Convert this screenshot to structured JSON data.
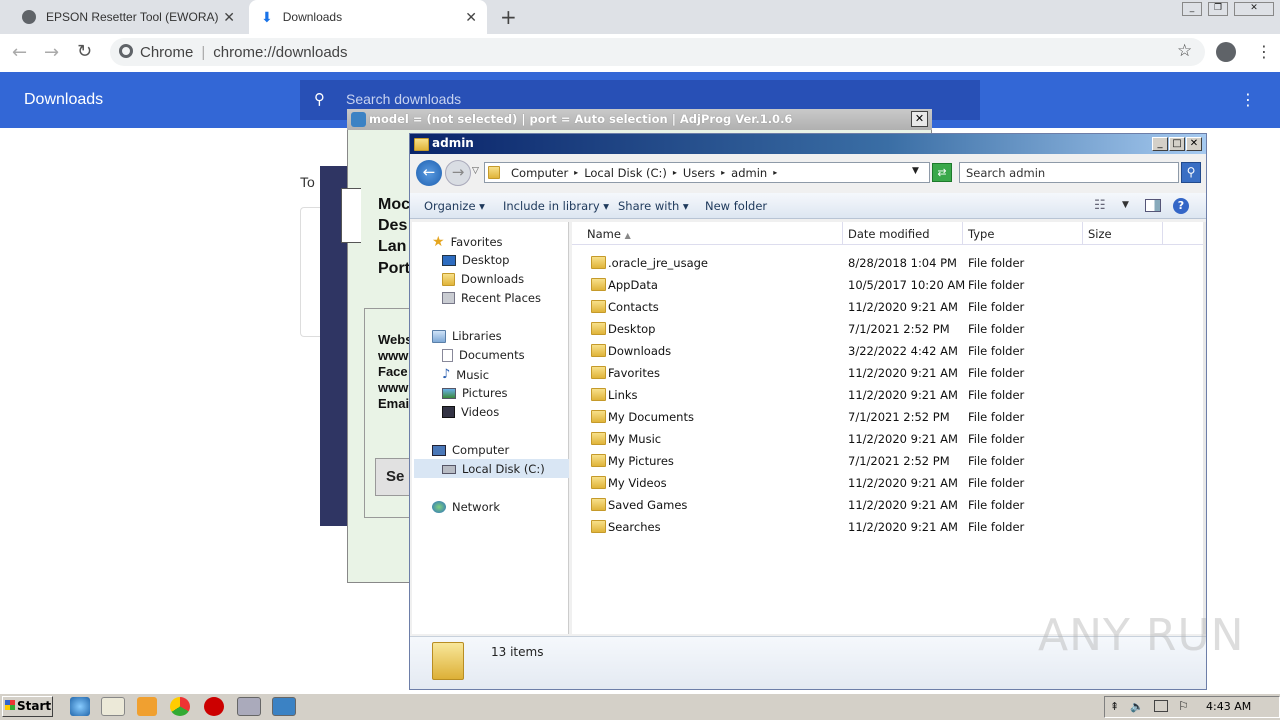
{
  "browser": {
    "tabs": [
      {
        "label": "EPSON Resetter Tool (EWORA)",
        "icon": "globe-icon"
      },
      {
        "label": "Downloads",
        "icon": "download-icon"
      }
    ],
    "omnibox": {
      "site": "Chrome",
      "url": "chrome://downloads"
    },
    "downloads_title": "Downloads",
    "search_placeholder": "Search downloads",
    "partial_today": "To"
  },
  "adjprog": {
    "title": "model = (not selected) | port = Auto selection | AdjProg Ver.1.0.6",
    "close": "✕",
    "labels": [
      "Moc",
      "Des",
      "Lan",
      "Port"
    ],
    "info": [
      "Webs",
      "www",
      "Face",
      "www",
      "Emai"
    ],
    "button": "Se"
  },
  "explorer": {
    "title": "admin",
    "breadcrumb": [
      "Computer",
      "Local Disk (C:)",
      "Users",
      "admin"
    ],
    "search_placeholder": "Search admin",
    "commands": [
      "Organize",
      "Include in library",
      "Share with",
      "New folder"
    ],
    "nav": {
      "favorites": "Favorites",
      "favorites_items": [
        "Desktop",
        "Downloads",
        "Recent Places"
      ],
      "libraries": "Libraries",
      "libraries_items": [
        "Documents",
        "Music",
        "Pictures",
        "Videos"
      ],
      "computer": "Computer",
      "computer_items": [
        "Local Disk (C:)"
      ],
      "network": "Network"
    },
    "columns": [
      "Name",
      "Date modified",
      "Type",
      "Size"
    ],
    "files": [
      {
        "name": ".oracle_jre_usage",
        "date": "8/28/2018 1:04 PM",
        "type": "File folder"
      },
      {
        "name": "AppData",
        "date": "10/5/2017 10:20 AM",
        "type": "File folder"
      },
      {
        "name": "Contacts",
        "date": "11/2/2020 9:21 AM",
        "type": "File folder"
      },
      {
        "name": "Desktop",
        "date": "7/1/2021 2:52 PM",
        "type": "File folder"
      },
      {
        "name": "Downloads",
        "date": "3/22/2022 4:42 AM",
        "type": "File folder"
      },
      {
        "name": "Favorites",
        "date": "11/2/2020 9:21 AM",
        "type": "File folder"
      },
      {
        "name": "Links",
        "date": "11/2/2020 9:21 AM",
        "type": "File folder"
      },
      {
        "name": "My Documents",
        "date": "7/1/2021 2:52 PM",
        "type": "File folder"
      },
      {
        "name": "My Music",
        "date": "11/2/2020 9:21 AM",
        "type": "File folder"
      },
      {
        "name": "My Pictures",
        "date": "7/1/2021 2:52 PM",
        "type": "File folder"
      },
      {
        "name": "My Videos",
        "date": "11/2/2020 9:21 AM",
        "type": "File folder"
      },
      {
        "name": "Saved Games",
        "date": "11/2/2020 9:21 AM",
        "type": "File folder"
      },
      {
        "name": "Searches",
        "date": "11/2/2020 9:21 AM",
        "type": "File folder"
      }
    ],
    "item_count": "13 items"
  },
  "taskbar": {
    "start": "Start",
    "clock": "4:43 AM"
  },
  "watermark": "ANY RUN"
}
